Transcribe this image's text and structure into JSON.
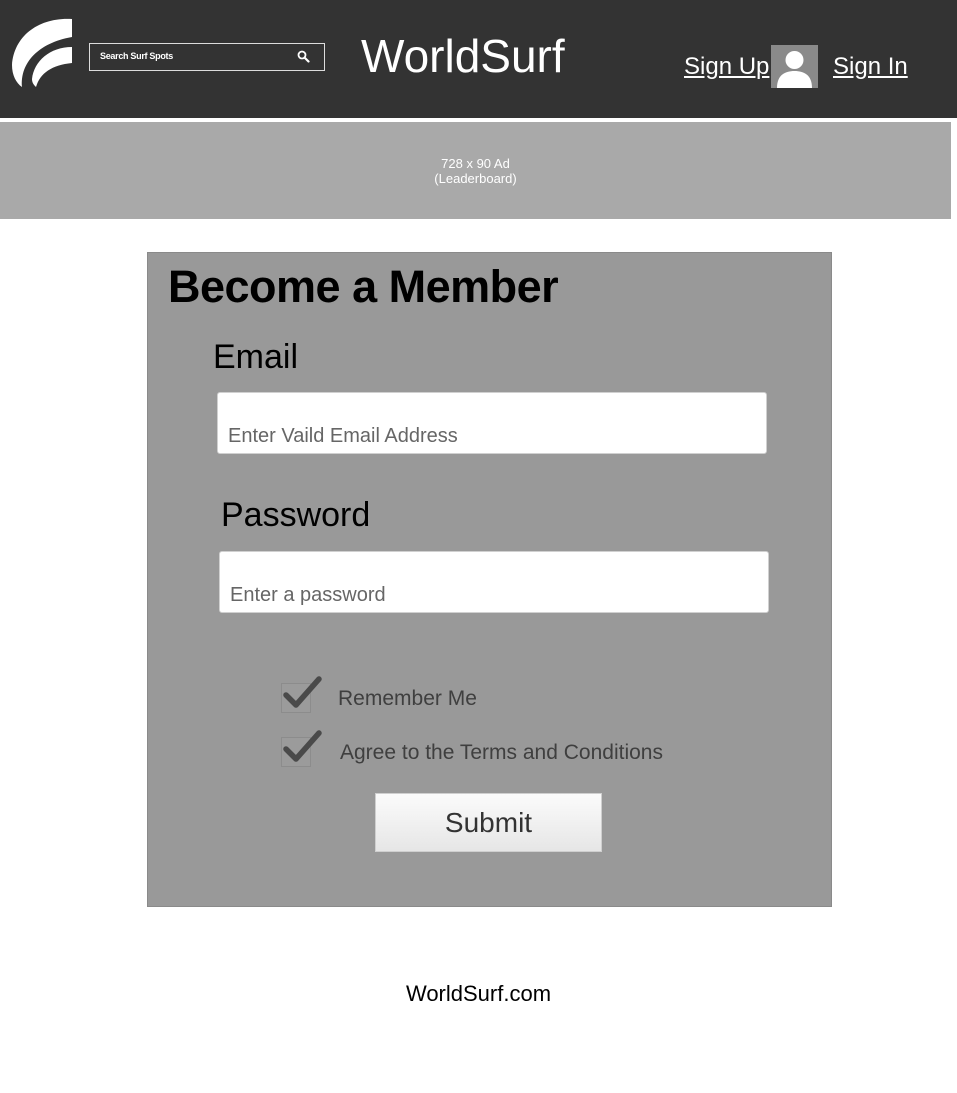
{
  "header": {
    "logo_icon": "surf-wave-logo-icon",
    "search": {
      "placeholder": "Search Surf Spots",
      "icon": "search-icon"
    },
    "title": "WorldSurf",
    "sign_up": "Sign Up",
    "avatar_icon": "user-avatar-icon",
    "sign_in": "Sign In"
  },
  "ad": {
    "line1": "728 x 90 Ad",
    "line2": "(Leaderboard)"
  },
  "form": {
    "title": "Become a Member",
    "email_label": "Email",
    "email_placeholder": "Enter Vaild Email Address",
    "password_label": "Password",
    "password_placeholder": "Enter a password",
    "remember_me": {
      "label": "Remember Me",
      "checked": true
    },
    "agree_terms": {
      "label": "Agree to the Terms and Conditions",
      "checked": true
    },
    "submit_label": "Submit"
  },
  "footer": {
    "text": "WorldSurf.com"
  },
  "colors": {
    "header_bg": "#333333",
    "ad_bg": "#a9a9a9",
    "panel_bg": "#999999",
    "checkmark": "#4a4a4a"
  }
}
